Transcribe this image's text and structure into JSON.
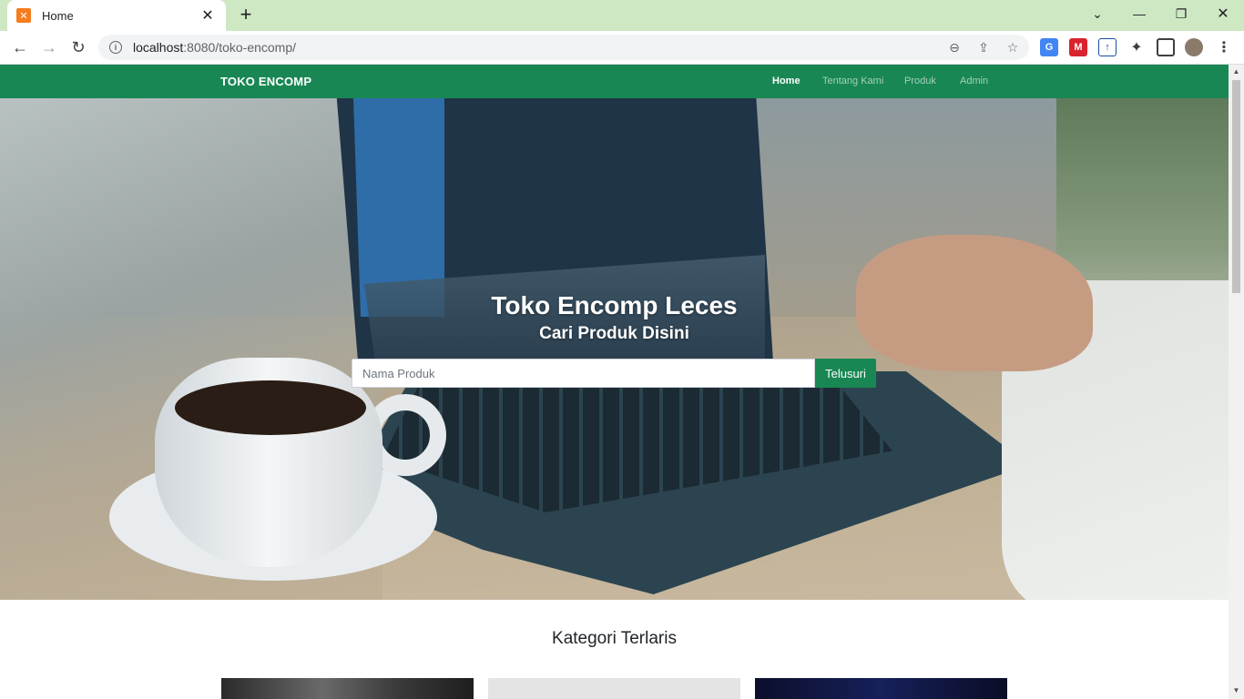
{
  "browser": {
    "tab_title": "Home",
    "url_host": "localhost",
    "url_rest": ":8080/toko-encomp/"
  },
  "navbar": {
    "brand": "TOKO ENCOMP",
    "links": [
      "Home",
      "Tentang Kami",
      "Produk",
      "Admin"
    ],
    "active": "Home",
    "color": "#198754"
  },
  "hero": {
    "title": "Toko Encomp Leces",
    "subtitle": "Cari Produk Disini",
    "search_placeholder": "Nama Produk",
    "search_button": "Telusuri"
  },
  "section": {
    "title": "Kategori Terlaris"
  },
  "colors": {
    "accent": "#198754",
    "tabbar": "#cfe8c4"
  }
}
